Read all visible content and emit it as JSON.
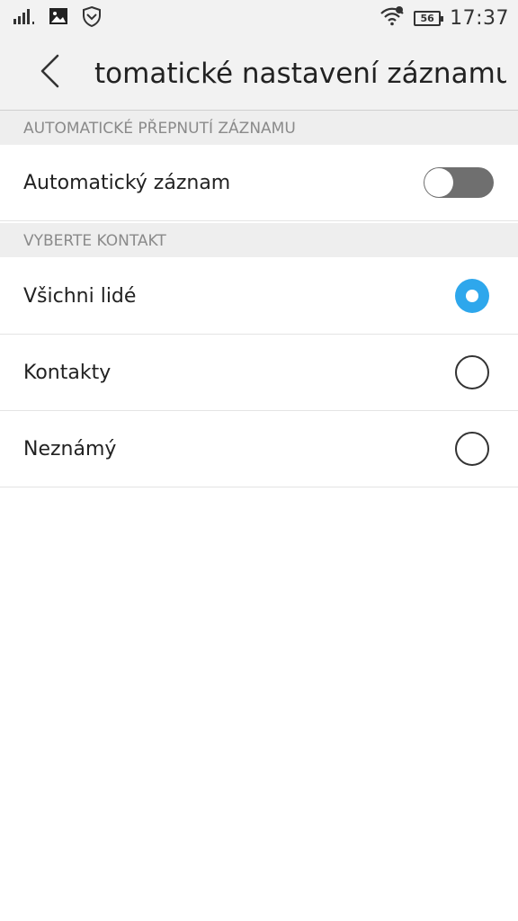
{
  "status_bar": {
    "time": "17:37",
    "battery_level": "56",
    "left_icons": [
      "signal-icon",
      "image-notification-icon",
      "shield-icon"
    ],
    "right_icons": [
      "wifi-icon",
      "battery-icon"
    ]
  },
  "header": {
    "back_icon": "chevron-left-icon",
    "title": "tomatické nastavení záznamu"
  },
  "sections": [
    {
      "header": "AUTOMATICKÉ PŘEPNUTÍ ZÁZNAMU",
      "items": [
        {
          "label": "Automatický záznam",
          "control": "toggle",
          "on": false
        }
      ]
    },
    {
      "header": "VYBERTE KONTAKT",
      "items": [
        {
          "label": "Všichni lidé",
          "control": "radio",
          "selected": true
        },
        {
          "label": "Kontakty",
          "control": "radio",
          "selected": false
        },
        {
          "label": "Neznámý",
          "control": "radio",
          "selected": false
        }
      ]
    }
  ],
  "colors": {
    "accent": "#2ea7ec",
    "toggle_off": "#6f6f6f",
    "section_header_bg": "#eeeeee",
    "app_bar_bg": "#f2f2f2"
  }
}
